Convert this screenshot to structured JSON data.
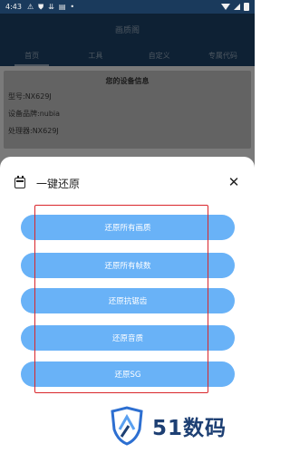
{
  "status_bar": {
    "time": "4:43",
    "icons": [
      "warning-icon",
      "shield-icon",
      "download-icon",
      "sim-icon",
      "dot-icon"
    ],
    "icon_glyphs": [
      "⚠",
      "⛊",
      "⇊",
      "▤",
      "•"
    ],
    "right_icons": [
      "wifi-icon",
      "signal-icon",
      "battery-icon"
    ]
  },
  "app": {
    "title": "画质阁",
    "tabs": [
      {
        "label": "首页",
        "active": true
      },
      {
        "label": "工具",
        "active": false
      },
      {
        "label": "自定义",
        "active": false
      },
      {
        "label": "专属代码",
        "active": false
      }
    ]
  },
  "device_info": {
    "title": "您的设备信息",
    "model": "型号:NX629J",
    "brand": "设备品牌:nubia",
    "processor": "处理器:NX629J"
  },
  "sheet": {
    "title": "一键还原",
    "close_glyph": "✕",
    "buttons": [
      "还原所有画质",
      "还原所有帧数",
      "还原抗锯齿",
      "还原音质",
      "还原SG"
    ]
  },
  "watermark": {
    "text": "51数码"
  },
  "colors": {
    "button": "#69b2f7",
    "highlight": "#d9262b",
    "appbar": "#1f466d"
  }
}
